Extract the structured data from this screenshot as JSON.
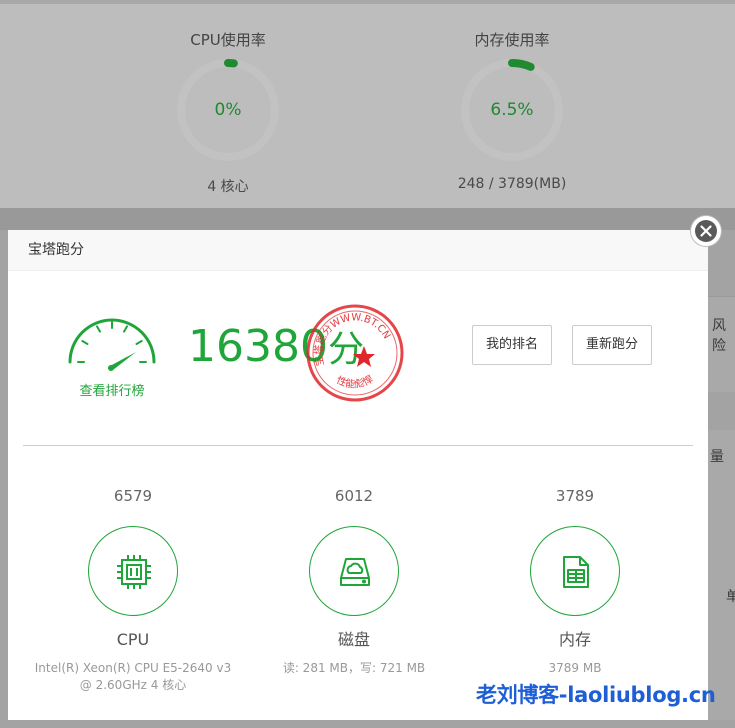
{
  "dashboard": {
    "cpu": {
      "title": "CPU使用率",
      "value": "0%",
      "sub": "4 核心",
      "level": 0.02
    },
    "memory": {
      "title": "内存使用率",
      "value": "6.5%",
      "sub": "248 / 3789(MB)",
      "level": 0.065
    },
    "side_labels": {
      "risk": "风险",
      "qty": "量",
      "dan": "单"
    }
  },
  "modal": {
    "title": "宝塔跑分",
    "rank_link": "查看排行榜",
    "score": "16380",
    "score_unit": "分",
    "seal": {
      "top_text": "宝塔跑分WWW.BT.CN",
      "bottom_text": "性能彪悍"
    },
    "buttons": {
      "my_rank": "我的排名",
      "retest": "重新跑分"
    },
    "items": [
      {
        "score": "6579",
        "name": "CPU",
        "detail": "Intel(R) Xeon(R) CPU E5-2640 v3 @ 2.60GHz 4 核心",
        "icon": "cpu-chip-icon"
      },
      {
        "score": "6012",
        "name": "磁盘",
        "detail": "读: 281 MB，写: 721 MB",
        "icon": "disk-icon"
      },
      {
        "score": "3789",
        "name": "内存",
        "detail": "3789 MB",
        "icon": "memory-icon"
      }
    ]
  },
  "watermark": "老刘博客-laoliublog.cn",
  "colors": {
    "accent": "#20a53a",
    "gauge_track": "#c2c2c2",
    "seal_red": "#e0262a",
    "watermark": "#1e5fd6"
  }
}
